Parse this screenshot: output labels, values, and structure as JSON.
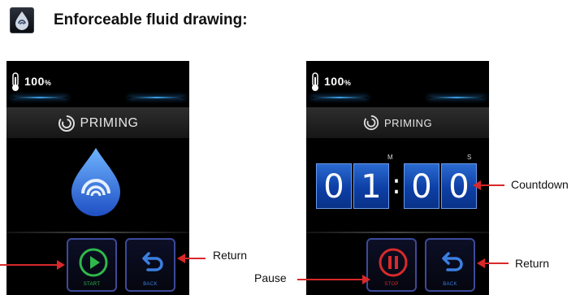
{
  "header": {
    "icon": "priming-swirl-icon",
    "title": "Enforceable fluid drawing:"
  },
  "screens": {
    "left": {
      "battery": "100",
      "battery_unit": "%",
      "title": "PRIMING",
      "buttons": {
        "start": {
          "label": "START",
          "icon": "play-icon",
          "color": "#2fb84a"
        },
        "back": {
          "label": "BACK",
          "icon": "return-arrow-icon",
          "color": "#3b7fe0"
        }
      }
    },
    "right": {
      "battery": "100",
      "battery_unit": "%",
      "title": "PRIMING",
      "countdown": {
        "digits": [
          "0",
          "1",
          "0",
          "0"
        ],
        "separator": ":",
        "minutes_unit": "M",
        "seconds_unit": "S"
      },
      "buttons": {
        "stop": {
          "label": "STOP",
          "icon": "pause-icon",
          "color": "#d82a2a"
        },
        "back": {
          "label": "BACK",
          "icon": "return-arrow-icon",
          "color": "#3b7fe0"
        }
      }
    }
  },
  "annotations": {
    "return_left": "Return",
    "countdown": "Countdown",
    "pause": "Pause",
    "return_right": "Return"
  },
  "colors": {
    "accent_blue": "#3aa0e8",
    "button_border": "#3c4a9a",
    "arrow_red": "#d8282a",
    "digit_blue": "#1a52c0"
  }
}
